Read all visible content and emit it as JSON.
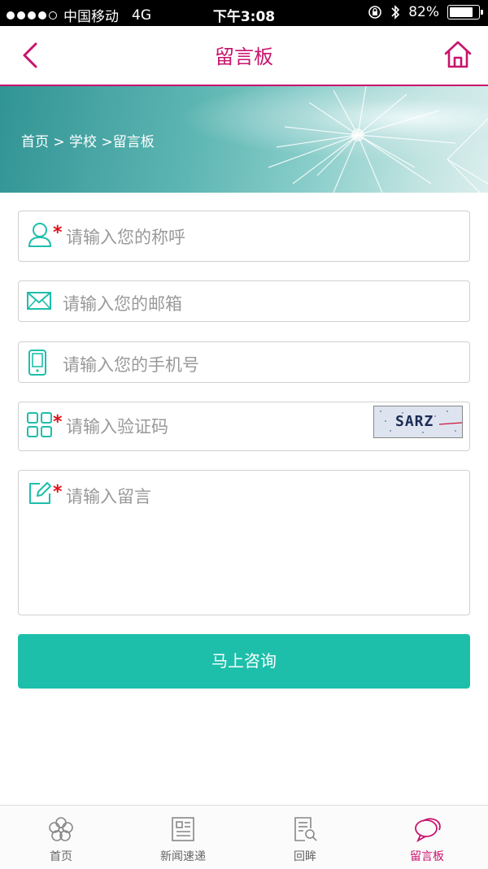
{
  "status_bar": {
    "carrier": "中国移动",
    "network": "4G",
    "time": "下午3:08",
    "battery": "82%",
    "battery_level": 0.82
  },
  "header": {
    "title": "留言板"
  },
  "banner": {
    "breadcrumb": "首页 > 学校 >留言板"
  },
  "form": {
    "name_placeholder": "请输入您的称呼",
    "email_placeholder": "请输入您的邮箱",
    "phone_placeholder": "请输入您的手机号",
    "captcha_placeholder": "请输入验证码",
    "captcha_text": "SARZ",
    "message_placeholder": "请输入留言",
    "required_mark": "*",
    "submit_label": "马上咨询"
  },
  "tabs": [
    {
      "label": "首页",
      "icon": "flower-icon",
      "active": false
    },
    {
      "label": "新闻速递",
      "icon": "newspaper-icon",
      "active": false
    },
    {
      "label": "回眸",
      "icon": "document-search-icon",
      "active": false
    },
    {
      "label": "留言板",
      "icon": "chat-bubble-icon",
      "active": true
    }
  ],
  "colors": {
    "accent": "#c8136d",
    "button": "#1dbfaa",
    "icon": "#1dbfaa",
    "required": "#e0101a"
  }
}
